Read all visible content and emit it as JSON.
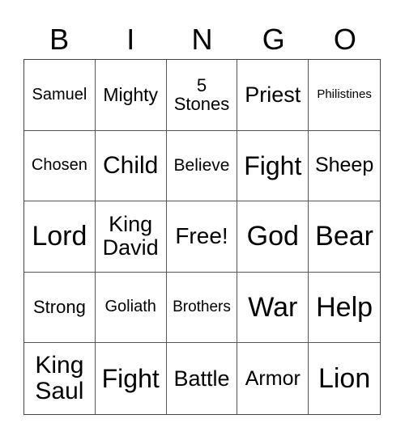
{
  "header": [
    "B",
    "I",
    "N",
    "G",
    "O"
  ],
  "cells": [
    "Samuel",
    "Mighty",
    "5\nStones",
    "Priest",
    "Philistines",
    "Chosen",
    "Child",
    "Believe",
    "Fight",
    "Sheep",
    "Lord",
    "King\nDavid",
    "Free!",
    "God",
    "Bear",
    "Strong",
    "Goliath",
    "Brothers",
    "War",
    "Help",
    "King\nSaul",
    "Fight",
    "Battle",
    "Armor",
    "Lion"
  ]
}
